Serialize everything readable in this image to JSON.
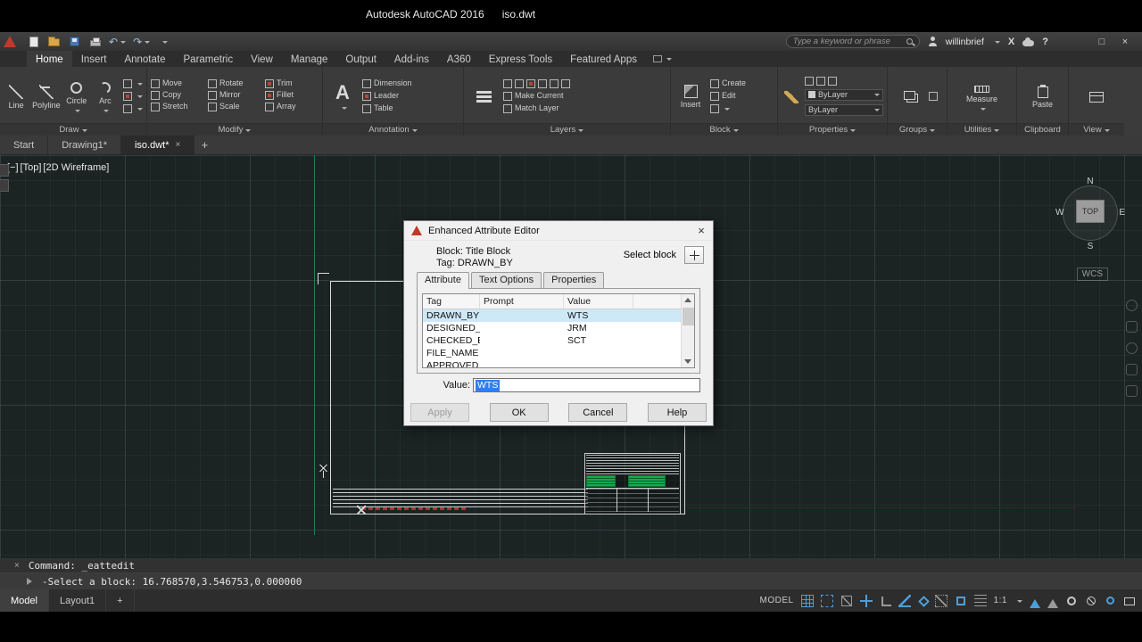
{
  "titlebar": {
    "app_title": "Autodesk AutoCAD 2016",
    "doc_title": "iso.dwt"
  },
  "icons": {
    "undo": "↶",
    "redo": "↷",
    "close": "×",
    "minimize": "—",
    "maximize": "□",
    "help": "?",
    "exchange": "X",
    "plus": "+",
    "text_tool": "A"
  },
  "qat": {
    "search_placeholder": "Type a keyword or phrase",
    "username": "willinbrief"
  },
  "ribbon_tabs": [
    {
      "label": "Home",
      "active": true
    },
    {
      "label": "Insert"
    },
    {
      "label": "Annotate"
    },
    {
      "label": "Parametric"
    },
    {
      "label": "View"
    },
    {
      "label": "Manage"
    },
    {
      "label": "Output"
    },
    {
      "label": "Add-ins"
    },
    {
      "label": "A360"
    },
    {
      "label": "Express Tools"
    },
    {
      "label": "Featured Apps"
    }
  ],
  "panels": {
    "draw": {
      "label": "Draw",
      "line": "Line",
      "polyline": "Polyline",
      "circle": "Circle",
      "arc": "Arc"
    },
    "modify": {
      "label": "Modify",
      "items": [
        "Move",
        "Rotate",
        "Trim",
        "Copy",
        "Mirror",
        "Fillet",
        "Stretch",
        "Scale",
        "Array"
      ]
    },
    "annotation": {
      "label": "Annotation",
      "dimension": "Dimension",
      "leader": "Leader",
      "table": "Table"
    },
    "layers": {
      "label": "Layers",
      "make_current": "Make Current",
      "match_layer": "Match Layer"
    },
    "block": {
      "label": "Block",
      "insert": "Insert",
      "create": "Create",
      "edit": "Edit"
    },
    "properties": {
      "label": "Properties",
      "combo_top": "ByLayer",
      "combo_bottom": "ByLayer"
    },
    "groups": {
      "label": "Groups"
    },
    "utilities": {
      "label": "Utilities",
      "measure": "Measure"
    },
    "clipboard": {
      "label": "Clipboard",
      "paste": "Paste"
    },
    "view": {
      "label": "View"
    }
  },
  "file_tabs": {
    "start": "Start",
    "drawing1": "Drawing1*",
    "iso": "iso.dwt*"
  },
  "viewport": {
    "minimize_control": "[−]",
    "view_control": "[Top]",
    "style_control": "[2D Wireframe]",
    "compass": {
      "n": "N",
      "e": "E",
      "s": "S",
      "w": "W",
      "top": "TOP"
    },
    "ucs_label": "WCS"
  },
  "dialog": {
    "title": "Enhanced Attribute Editor",
    "block_line": "Block: Title Block",
    "tag_line": "Tag: DRAWN_BY",
    "select_block_label": "Select block",
    "tabs": {
      "attribute": "Attribute",
      "text_options": "Text Options",
      "properties": "Properties"
    },
    "table": {
      "headers": {
        "tag": "Tag",
        "prompt": "Prompt",
        "value": "Value"
      },
      "rows": [
        {
          "tag": "DRAWN_BY",
          "prompt": "",
          "value": "WTS"
        },
        {
          "tag": "DESIGNED_...",
          "prompt": "",
          "value": "JRM"
        },
        {
          "tag": "CHECKED_BY",
          "prompt": "",
          "value": "SCT"
        },
        {
          "tag": "FILE_NAME",
          "prompt": "",
          "value": ""
        },
        {
          "tag": "APPROVED",
          "prompt": "",
          "value": ""
        }
      ]
    },
    "value_label": "Value:",
    "value_text": "WTS",
    "buttons": {
      "apply": "Apply",
      "ok": "OK",
      "cancel": "Cancel",
      "help": "Help"
    }
  },
  "command": {
    "history_line": "Command: _eattedit",
    "prompt_line": "-Select a block: 16.768570,3.546753,0.000000"
  },
  "status": {
    "model_tab": "Model",
    "layout_tab": "Layout1",
    "add_layout": "+",
    "space_label": "MODEL",
    "scale_label": "1:1"
  }
}
